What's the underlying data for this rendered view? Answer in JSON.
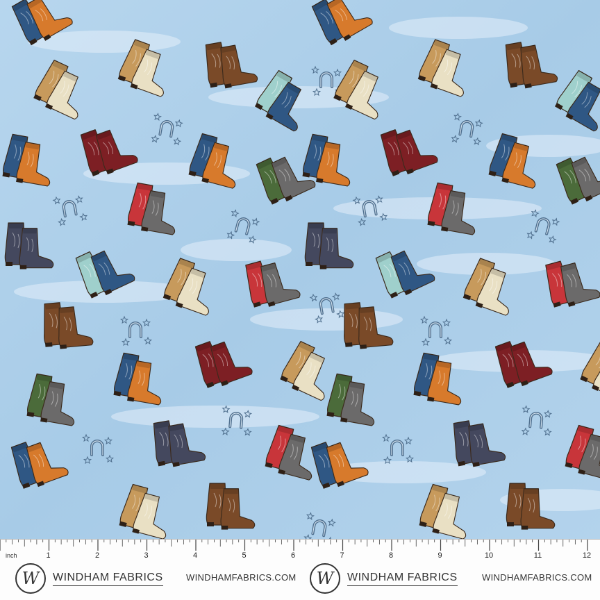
{
  "colors": {
    "sky": "#a9cde8",
    "sky_light": "#cfe4f4",
    "sky_dark": "#8fbbdd",
    "tan": "#c79a5c",
    "brown": "#7a4a28",
    "orange": "#d77a2c",
    "denim": "#2f5784",
    "cream": "#e9e0c4",
    "maroon": "#7d1f24",
    "red": "#c8353a",
    "teal": "#9fd0cc",
    "green": "#4b6b3a",
    "navy": "#44485e",
    "gray": "#6b6a6a",
    "stamp": "#4f6f8e"
  },
  "ruler": {
    "unit_label": "inch",
    "numbers": [
      "1",
      "2",
      "3",
      "4",
      "5",
      "6",
      "7",
      "8",
      "9",
      "10",
      "11",
      "12"
    ]
  },
  "branding": {
    "logo_letter": "W",
    "name": "WINDHAM FABRICS",
    "url": "WINDHAMFABRICS.COM"
  },
  "motifs": [
    {
      "kind": "boot-pair",
      "colors": [
        "denim",
        "orange"
      ]
    },
    {
      "kind": "boot-pair",
      "colors": [
        "tan",
        "cream"
      ]
    },
    {
      "kind": "boot-pair",
      "colors": [
        "brown",
        "brown"
      ]
    },
    {
      "kind": "boot-pair",
      "colors": [
        "teal",
        "denim"
      ]
    },
    {
      "kind": "boot-pair",
      "colors": [
        "maroon",
        "maroon"
      ]
    },
    {
      "kind": "boot-pair",
      "colors": [
        "red",
        "gray"
      ]
    },
    {
      "kind": "boot-pair",
      "colors": [
        "green",
        "gray"
      ]
    },
    {
      "kind": "boot-pair",
      "colors": [
        "navy",
        "navy"
      ]
    },
    {
      "kind": "horseshoe-stars",
      "colors": [
        "stamp"
      ]
    }
  ]
}
